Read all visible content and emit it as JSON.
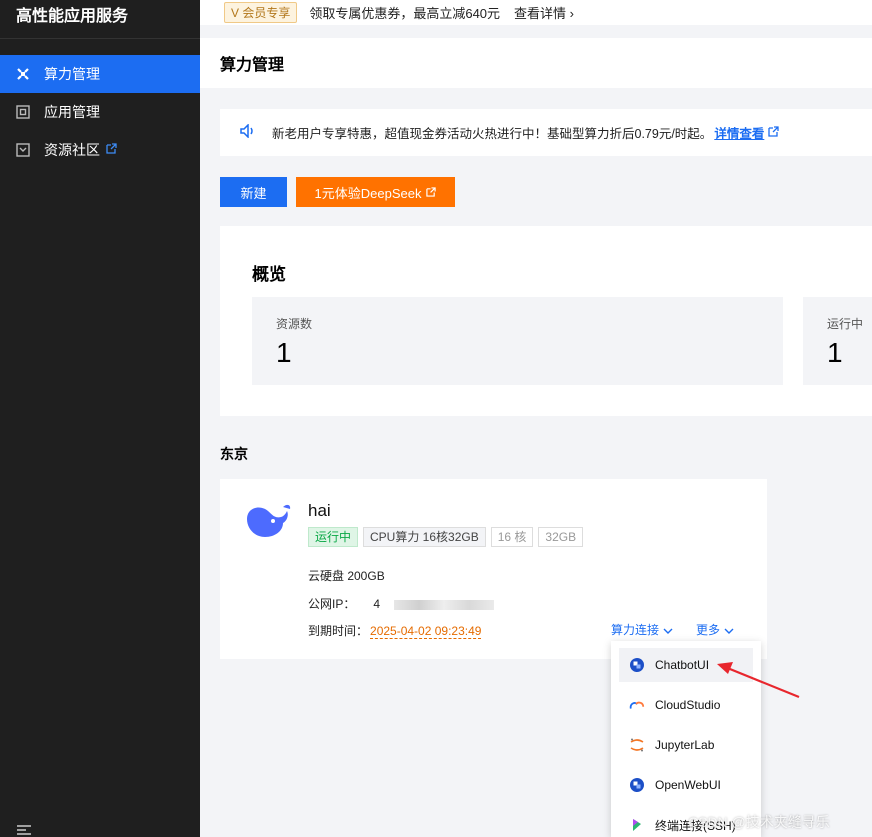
{
  "sidebar": {
    "title": "高性能应用服务",
    "items": [
      {
        "label": "算力管理",
        "icon": "compute-icon"
      },
      {
        "label": "应用管理",
        "icon": "app-icon"
      },
      {
        "label": "资源社区",
        "icon": "community-icon"
      }
    ]
  },
  "promo": {
    "badge": "V 会员专享",
    "text": "领取专属优惠券，最高立减640元",
    "link": "查看详情 ›"
  },
  "page": {
    "title": "算力管理"
  },
  "notice": {
    "text": "新老用户专享特惠，超值现金券活动火热进行中！基础型算力折后0.79元/时起。",
    "link": "详情查看"
  },
  "actions": {
    "new": "新建",
    "deepseek": "1元体验DeepSeek"
  },
  "overview": {
    "title": "概览",
    "stats": [
      {
        "label": "资源数",
        "value": "1"
      },
      {
        "label": "运行中",
        "value": "1"
      }
    ]
  },
  "region": "东京",
  "instance": {
    "name": "hai",
    "status": "运行中",
    "spec": "CPU算力 16核32GB",
    "cores": "16 核",
    "mem": "32GB",
    "disk": "云硬盘 200GB",
    "ip_label": "公网IP：",
    "ip_visible": "4",
    "expire_label": "到期时间：",
    "expire": "2025-04-02 09:23:49",
    "connect": "算力连接",
    "more": "更多"
  },
  "dropdown": [
    {
      "label": "ChatbotUI",
      "icon": "chatbotui-icon"
    },
    {
      "label": "CloudStudio",
      "icon": "cloudstudio-icon"
    },
    {
      "label": "JupyterLab",
      "icon": "jupyter-icon"
    },
    {
      "label": "OpenWebUI",
      "icon": "openwebui-icon"
    },
    {
      "label": "终端连接(SSH)",
      "icon": "ssh-icon"
    }
  ],
  "watermark": "CSDN @技术夹缝寻乐",
  "colors": {
    "primary": "#1c6df2",
    "orange": "#ff7200",
    "sidebar": "#1f1f1f",
    "running": "#0aa846"
  }
}
